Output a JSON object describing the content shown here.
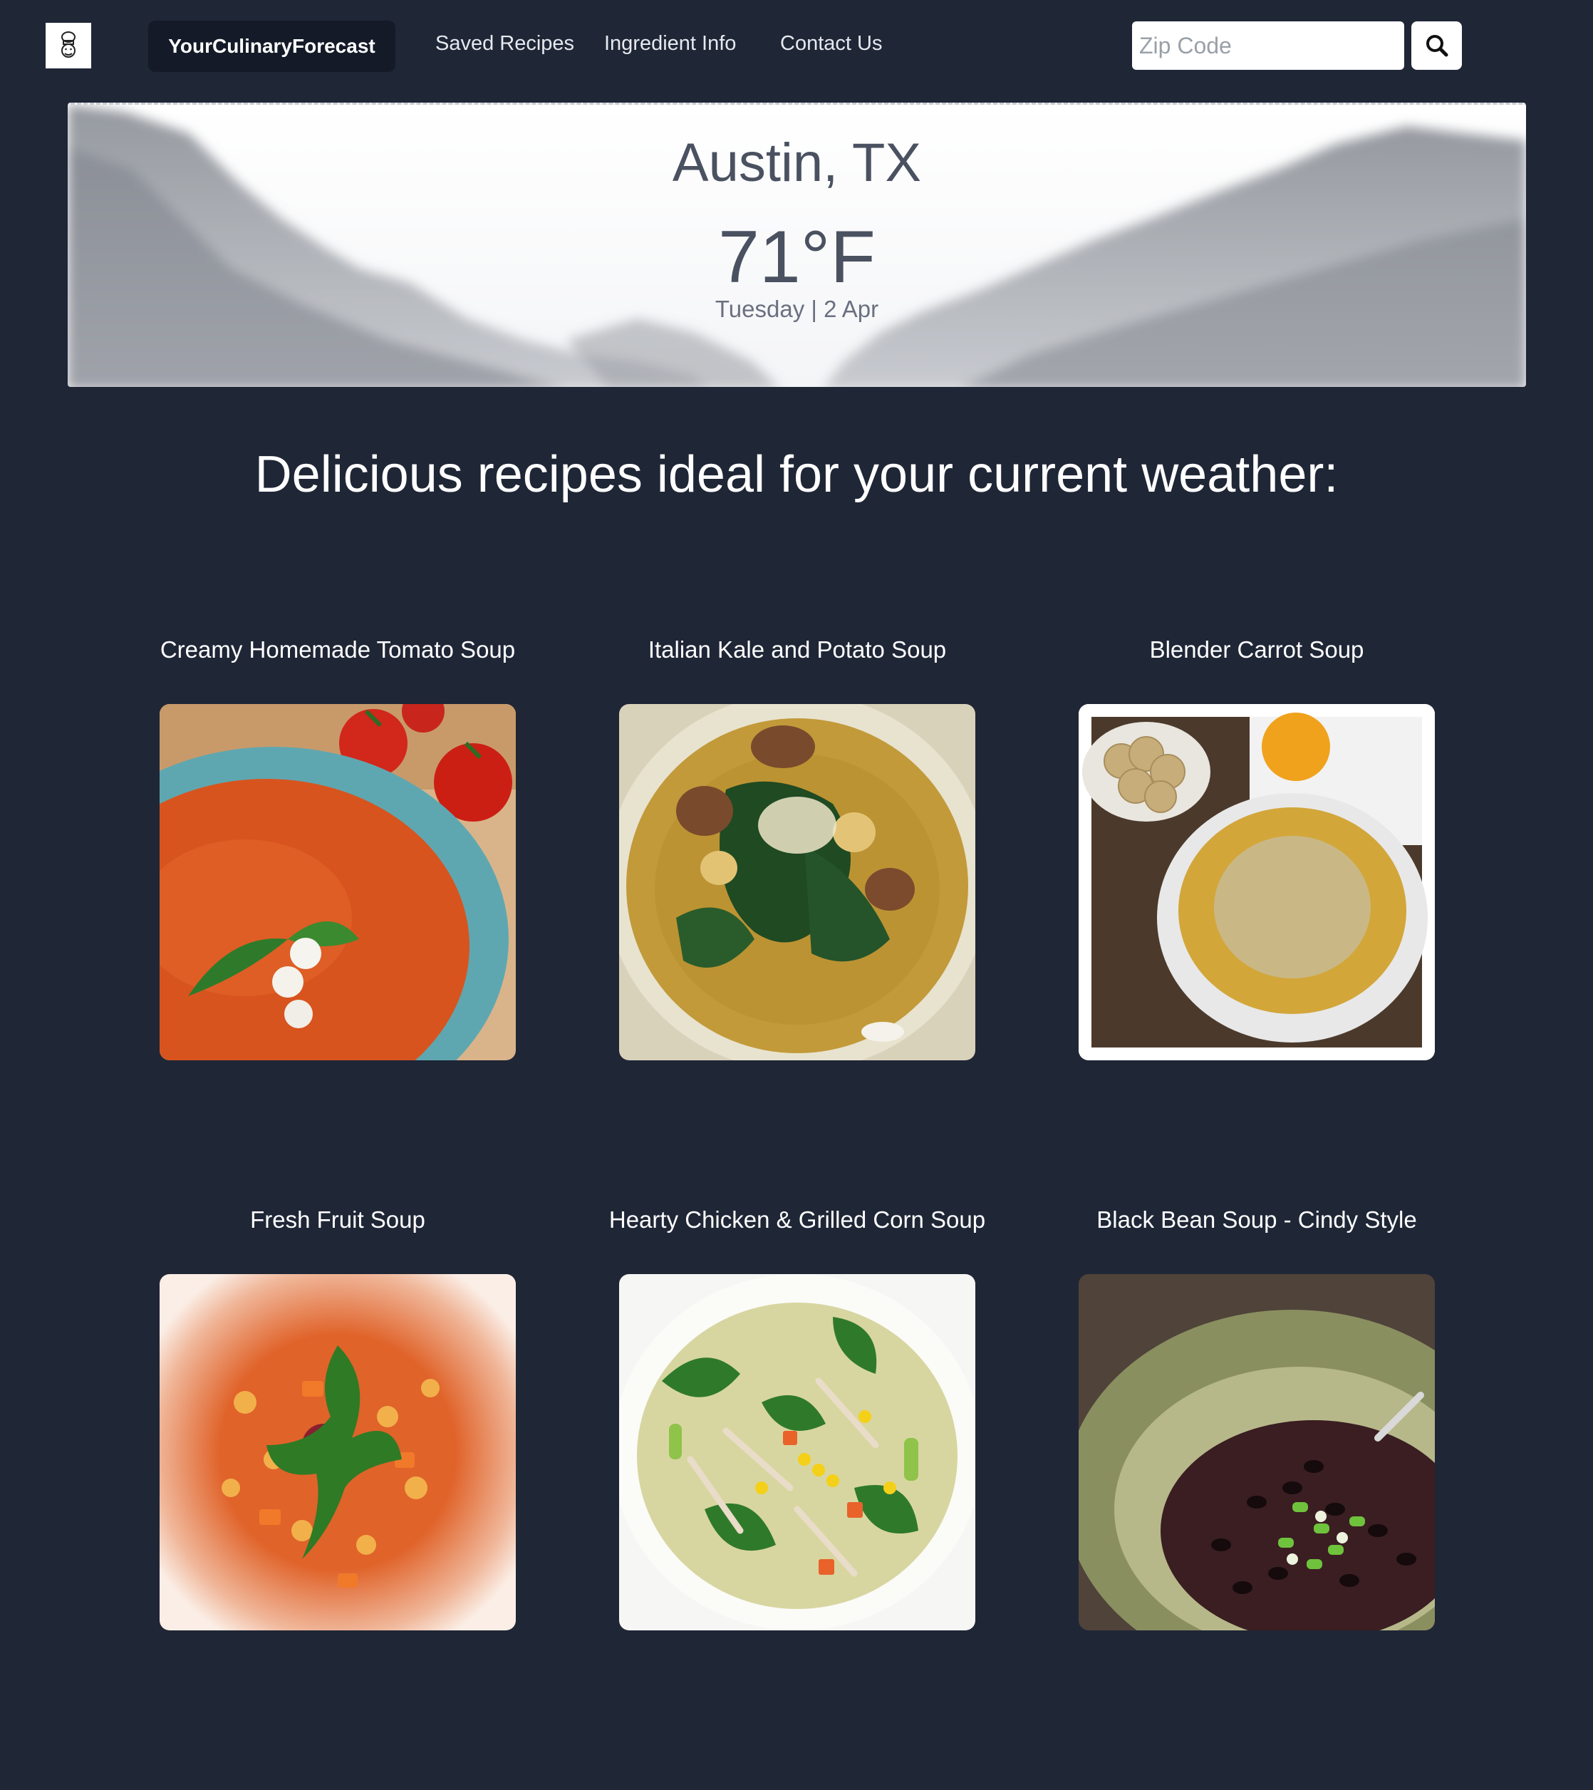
{
  "navbar": {
    "brand": "YourCulinaryForecast",
    "links": [
      "Saved Recipes",
      "Ingredient Info",
      "Contact Us"
    ],
    "search": {
      "placeholder": "Zip Code",
      "value": ""
    }
  },
  "weather": {
    "city": "Austin, TX",
    "temperature": "71°F",
    "date": "Tuesday | 2 Apr"
  },
  "headline": "Delicious recipes ideal for your current weather:",
  "recipes": [
    {
      "title": "Creamy Homemade Tomato Soup"
    },
    {
      "title": "Italian Kale and Potato Soup"
    },
    {
      "title": "Blender Carrot Soup"
    },
    {
      "title": "Fresh Fruit Soup"
    },
    {
      "title": "Hearty Chicken & Grilled Corn Soup"
    },
    {
      "title": "Black Bean Soup - Cindy Style"
    }
  ],
  "colors": {
    "background": "#1f2636",
    "brand_bg": "#141a27",
    "text": "#ffffff"
  }
}
